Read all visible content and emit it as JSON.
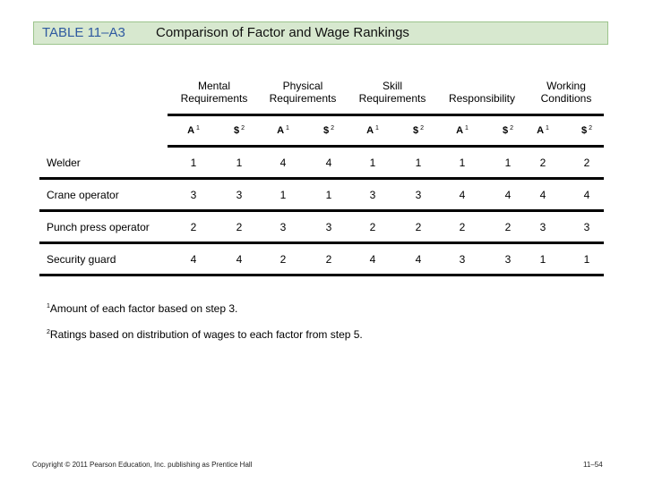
{
  "title": {
    "number": "TABLE 11–A3",
    "text": "Comparison of Factor and Wage Rankings",
    "background_color": "#d7e8cf",
    "number_color": "#2f5aa0"
  },
  "factors": [
    {
      "line1": "Mental",
      "line2": "Requirements"
    },
    {
      "line1": "Physical",
      "line2": "Requirements"
    },
    {
      "line1": "Skill",
      "line2": "Requirements"
    },
    {
      "line1": "",
      "line2": "Responsibility"
    },
    {
      "line1": "Working",
      "line2": "Conditions"
    }
  ],
  "subheaders": {
    "a_label": "A",
    "a_sup": "1",
    "s_label": "$",
    "s_sup": "2"
  },
  "rows": [
    {
      "job": "Welder",
      "values": [
        "1",
        "1",
        "4",
        "4",
        "1",
        "1",
        "1",
        "1",
        "2",
        "2"
      ]
    },
    {
      "job": "Crane operator",
      "values": [
        "3",
        "3",
        "1",
        "1",
        "3",
        "3",
        "4",
        "4",
        "4",
        "4"
      ]
    },
    {
      "job": "Punch press operator",
      "values": [
        "2",
        "2",
        "3",
        "3",
        "2",
        "2",
        "2",
        "2",
        "3",
        "3"
      ]
    },
    {
      "job": "Security guard",
      "values": [
        "4",
        "4",
        "2",
        "2",
        "4",
        "4",
        "3",
        "3",
        "1",
        "1"
      ]
    }
  ],
  "notes": [
    {
      "sup": "1",
      "text": "Amount of each factor based on step 3."
    },
    {
      "sup": "2",
      "text": "Ratings based on distribution of wages to each factor from step 5."
    }
  ],
  "footer": {
    "copyright": "Copyright © 2011 Pearson Education, Inc. publishing as Prentice Hall",
    "page": "11–54"
  }
}
